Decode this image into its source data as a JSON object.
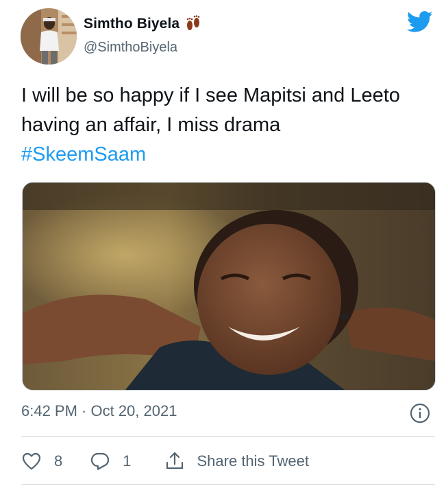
{
  "tweet": {
    "author": {
      "display_name": "Simtho Biyela",
      "handle": "@SimthoBiyela",
      "avatar_icon": "profile-photo",
      "name_emoji": "footprints-icon"
    },
    "platform_icon": "twitter-bird-icon",
    "text": "I will be so happy if I see Mapitsi and Leeto having an affair, I miss drama",
    "hashtag": "#SkeemSaam",
    "media_icon": "tweet-photo",
    "timestamp": "6:42 PM · Oct 20, 2021",
    "info_icon": "info-icon",
    "actions": {
      "like_icon": "heart-icon",
      "like_count": "8",
      "reply_icon": "reply-icon",
      "reply_count": "1",
      "share_icon": "share-icon",
      "share_label": "Share this Tweet"
    }
  },
  "colors": {
    "accent": "#1d9bf0",
    "text": "#0f1419",
    "secondary_text": "#536471",
    "divider": "#cfd9de"
  }
}
